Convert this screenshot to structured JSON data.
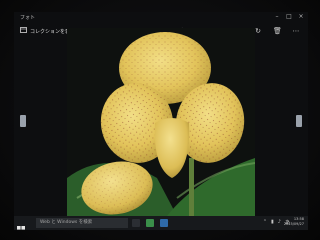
{
  "window": {
    "title": "フォト",
    "controls": [
      "minimize-icon",
      "maximize-icon",
      "close-icon"
    ]
  },
  "toolbar": {
    "collection_label": "コレクションを表示",
    "icons": [
      "share-icon",
      "slideshow-icon",
      "draw-icon",
      "edit-icon",
      "rotate-icon",
      "delete-icon",
      "more-icon"
    ]
  },
  "image": {
    "subject": "Yellow spotted slipper orchid (Paphiopedilum) with mottled green leaves"
  },
  "taskbar": {
    "search_placeholder": "Web と Windows を検索",
    "clock_time": "13:58",
    "clock_date": "2015/09/27"
  },
  "colors": {
    "screen_bg": "#0d0e10",
    "taskbar_bg": "#17191c",
    "flower_yellow": "#e6c85e",
    "leaf_green": "#2f6a2c"
  }
}
